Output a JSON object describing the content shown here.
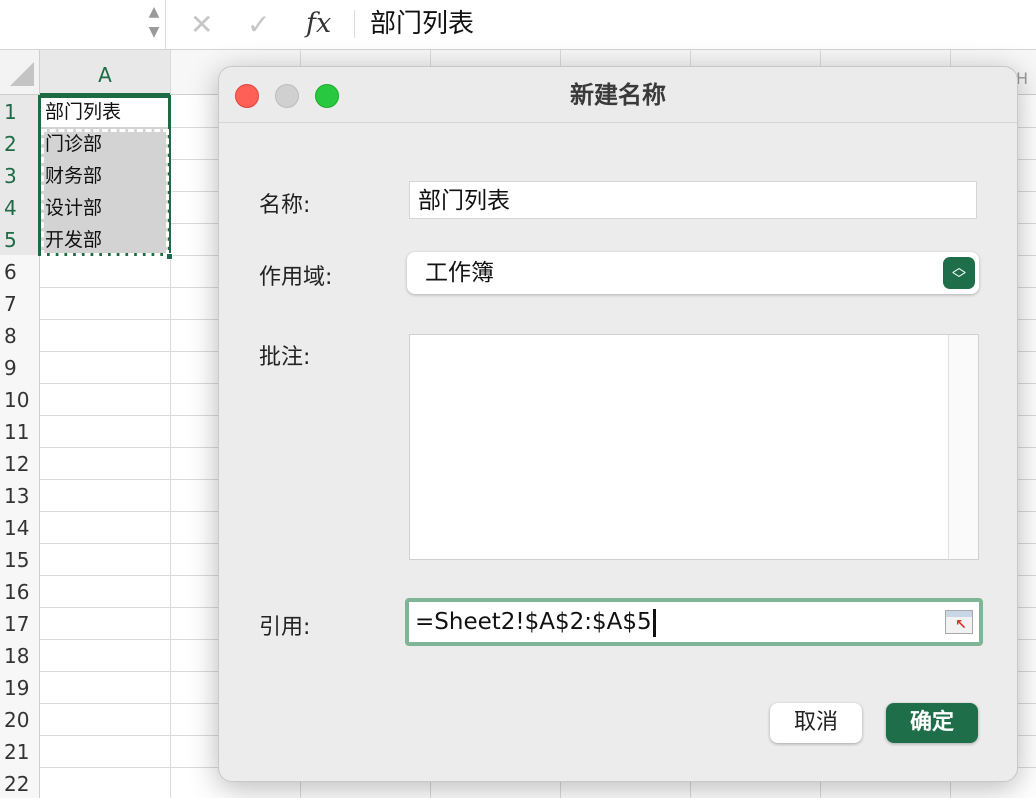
{
  "formula_bar": {
    "cancel_glyph": "✕",
    "confirm_glyph": "✓",
    "fx_label": "fx",
    "content": "部门列表"
  },
  "sheet": {
    "column_headers": [
      "A"
    ],
    "partial_column_header": "H",
    "row_numbers": [
      "1",
      "2",
      "3",
      "4",
      "5",
      "6",
      "7",
      "8",
      "9",
      "10",
      "11",
      "12",
      "13",
      "14",
      "15",
      "16",
      "17",
      "18",
      "19",
      "20",
      "21",
      "22"
    ],
    "cells": [
      "部门列表",
      "门诊部",
      "财务部",
      "设计部",
      "开发部"
    ]
  },
  "dialog": {
    "title": "新建名称",
    "name_label": "名称:",
    "name_value": "部门列表",
    "scope_label": "作用域:",
    "scope_value": "工作簿",
    "comment_label": "批注:",
    "comment_value": "",
    "reference_label": "引用:",
    "reference_value": "=Sheet2!$A$2:$A$5",
    "cancel_label": "取消",
    "ok_label": "确定"
  },
  "colors": {
    "accent_green": "#1e6f49",
    "selection_green": "#1d6b45",
    "close": "#fe5f57",
    "zoom": "#28c840",
    "minimize_inactive": "#d0d0d0"
  }
}
